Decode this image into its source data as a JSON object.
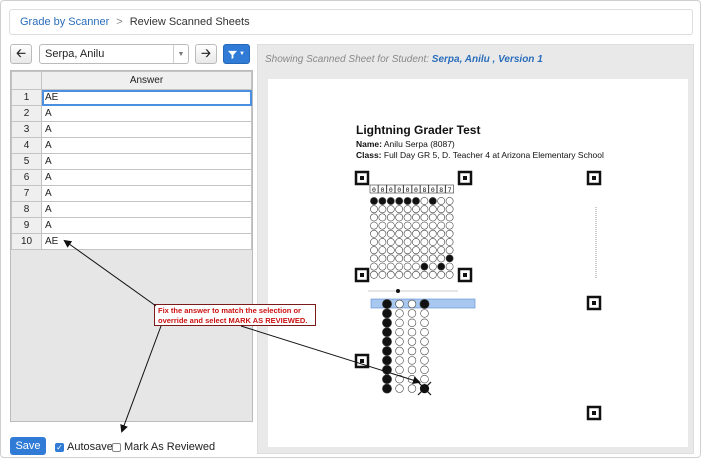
{
  "breadcrumb": {
    "link": "Grade by Scanner",
    "separator": ">",
    "current": "Review Scanned Sheets"
  },
  "toolbar": {
    "prev_icon": "arrow-left",
    "next_icon": "arrow-right",
    "filter_icon": "filter",
    "student": "Serpa, Anilu"
  },
  "grid": {
    "header": "Answer",
    "rows": [
      {
        "num": "1",
        "answer": "AE"
      },
      {
        "num": "2",
        "answer": "A"
      },
      {
        "num": "3",
        "answer": "A"
      },
      {
        "num": "4",
        "answer": "A"
      },
      {
        "num": "5",
        "answer": "A"
      },
      {
        "num": "6",
        "answer": "A"
      },
      {
        "num": "7",
        "answer": "A"
      },
      {
        "num": "8",
        "answer": "A"
      },
      {
        "num": "9",
        "answer": "A"
      },
      {
        "num": "10",
        "answer": "AE"
      }
    ]
  },
  "footer": {
    "save": "Save",
    "autosave": "Autosave",
    "autosave_checked": true,
    "mark_reviewed": "Mark As Reviewed",
    "mark_reviewed_checked": false
  },
  "viewer": {
    "header_prefix": "Showing Scanned Sheet for Student:",
    "header_student": "Serpa, Anilu , Version 1",
    "sheet_title": "Lightning Grader Test",
    "name_label": "Name:",
    "name_value": "Anilu Serpa (8087)",
    "class_label": "Class:",
    "class_value": "Full Day GR 5, D. Teacher 4 at Arizona Elementary School",
    "student_id_digits": [
      "0",
      "0",
      "0",
      "0",
      "0",
      "0",
      "8",
      "0",
      "8",
      "7"
    ]
  },
  "callout": {
    "text": "Fix the answer to match the selection or override and select MARK AS REVIEWED."
  },
  "colors": {
    "accent": "#2f7bd5",
    "callout_text": "#cc1111",
    "link": "#2a6ebb"
  }
}
